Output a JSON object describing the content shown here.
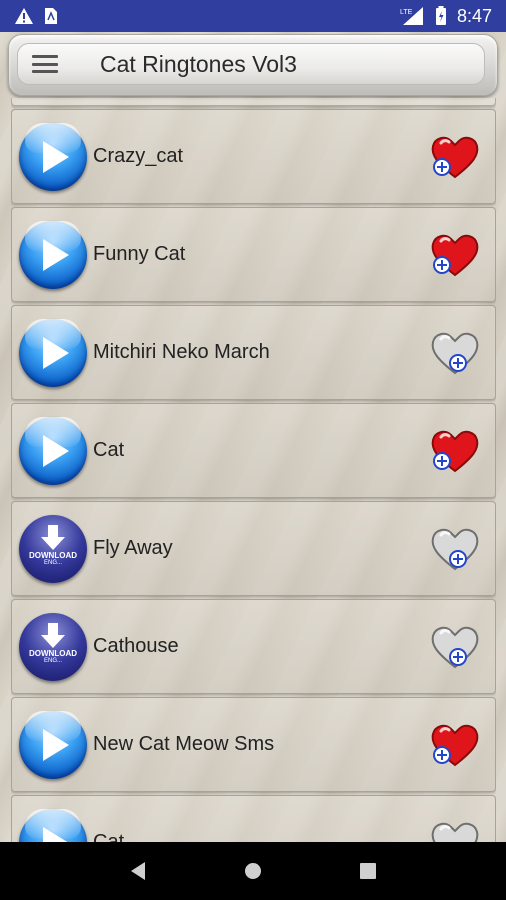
{
  "status_bar": {
    "time": "8:47",
    "left_icons": [
      "warning-icon",
      "sim-card-icon"
    ],
    "right_icons": [
      "lte-signal-icon",
      "battery-icon"
    ],
    "network_label": "LTE"
  },
  "toolbar": {
    "title": "Cat Ringtones Vol3",
    "menu_icon": "hamburger-menu-icon"
  },
  "list": {
    "items": [
      {
        "title": "Crazy_cat",
        "action": "play",
        "favorite": true
      },
      {
        "title": "Funny Cat",
        "action": "play",
        "favorite": true
      },
      {
        "title": "Mitchiri Neko March",
        "action": "play",
        "favorite": false
      },
      {
        "title": "Cat",
        "action": "play",
        "favorite": true
      },
      {
        "title": "Fly Away",
        "action": "download",
        "favorite": false
      },
      {
        "title": "Cathouse",
        "action": "download",
        "favorite": false
      },
      {
        "title": "New Cat Meow Sms",
        "action": "play",
        "favorite": true
      },
      {
        "title": "Cat",
        "action": "play",
        "favorite": false
      }
    ],
    "download_label": "DOWNLOAD",
    "download_sub_label": "ENG..."
  },
  "nav_bar": {
    "icons": [
      "back-icon",
      "home-icon",
      "recents-icon"
    ]
  },
  "colors": {
    "status_bar": "#303f9f",
    "heart_favorite": "#e0151c",
    "heart_not_favorite": "#d9d9d9",
    "play_button": "#1f80e0",
    "download_button": "#24287a"
  }
}
